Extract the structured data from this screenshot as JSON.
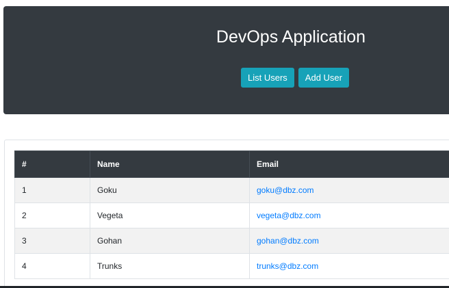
{
  "header": {
    "title": "DevOps Application",
    "list_users_label": "List Users",
    "add_user_label": "Add User"
  },
  "table": {
    "columns": [
      "#",
      "Name",
      "Email"
    ],
    "rows": [
      {
        "num": "1",
        "name": "Goku",
        "email": "goku@dbz.com"
      },
      {
        "num": "2",
        "name": "Vegeta",
        "email": "vegeta@dbz.com"
      },
      {
        "num": "3",
        "name": "Gohan",
        "email": "gohan@dbz.com"
      },
      {
        "num": "4",
        "name": "Trunks",
        "email": "trunks@dbz.com"
      }
    ]
  },
  "colors": {
    "header_bg": "#343a40",
    "button_bg": "#17a2b8",
    "link": "#007bff",
    "stripe": "#f2f2f2"
  }
}
